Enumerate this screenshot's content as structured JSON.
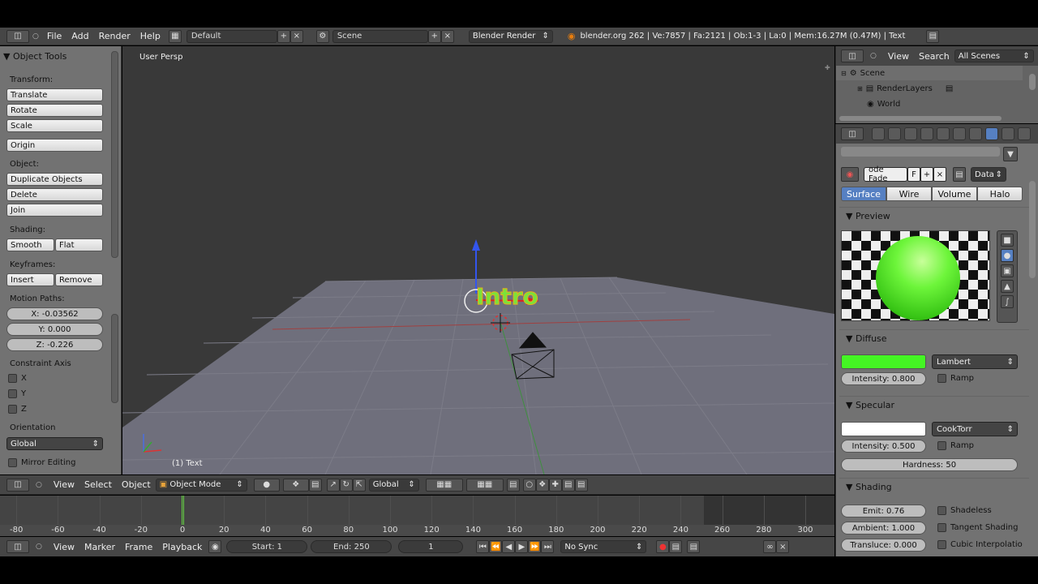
{
  "top": {
    "menus": [
      "File",
      "Add",
      "Render",
      "Help"
    ],
    "layout": "Default",
    "scene": "Scene",
    "engine": "Blender Render",
    "stats": "blender.org 262 | Ve:7857 | Fa:2121 | Ob:1-3 | La:0 | Mem:16.27M (0.47M) | Text"
  },
  "toolshelf": {
    "title": "Object Tools",
    "transform_label": "Transform:",
    "translate": "Translate",
    "rotate": "Rotate",
    "scale": "Scale",
    "origin": "Origin",
    "object_label": "Object:",
    "duplicate": "Duplicate Objects",
    "delete": "Delete",
    "join": "Join",
    "shading_label": "Shading:",
    "smooth": "Smooth",
    "flat": "Flat",
    "keyframes_label": "Keyframes:",
    "insert": "Insert",
    "remove": "Remove",
    "motion_label": "Motion Paths:",
    "x": "X: -0.03562",
    "y": "Y: 0.000",
    "z": "Z: -0.226",
    "constraint_label": "Constraint Axis",
    "cx": "X",
    "cy": "Y",
    "cz": "Z",
    "orientation_label": "Orientation",
    "orientation": "Global",
    "mirror": "Mirror Editing"
  },
  "viewport": {
    "view_name": "User Persp",
    "object_label": "(1) Text",
    "text_object": "Intro"
  },
  "vp_header": {
    "view": "View",
    "select": "Select",
    "object": "Object",
    "mode": "Object Mode",
    "orientation": "Global"
  },
  "timeline": {
    "ticks": [
      "-80",
      "-60",
      "-40",
      "-20",
      "0",
      "20",
      "40",
      "60",
      "80",
      "100",
      "120",
      "140",
      "160",
      "180",
      "200",
      "220",
      "240",
      "260",
      "280",
      "300"
    ],
    "current_frame_marker": 0
  },
  "tl_header": {
    "view": "View",
    "marker": "Marker",
    "frame": "Frame",
    "playback": "Playback",
    "start": "Start: 1",
    "end": "End: 250",
    "current": "1",
    "sync": "No Sync"
  },
  "outliner": {
    "view": "View",
    "search": "Search",
    "filter": "All Scenes",
    "scene": "Scene",
    "renderlayers": "RenderLayers",
    "world": "World"
  },
  "properties": {
    "material_name": "ode Fade",
    "fake_user": "F",
    "data": "Data",
    "tabs": [
      "Surface",
      "Wire",
      "Volume",
      "Halo"
    ],
    "preview": "Preview",
    "diffuse": "Diffuse",
    "diffuse_color": "#44f524",
    "diffuse_shader": "Lambert",
    "diffuse_intensity": "Intensity: 0.800",
    "ramp": "Ramp",
    "specular": "Specular",
    "specular_color": "#ffffff",
    "specular_shader": "CookTorr",
    "specular_intensity": "Intensity: 0.500",
    "hardness": "Hardness: 50",
    "shading": "Shading",
    "emit": "Emit: 0.76",
    "ambient": "Ambient: 1.000",
    "translucency": "Transluce: 0.000",
    "shadeless": "Shadeless",
    "tangent": "Tangent Shading",
    "cubic": "Cubic Interpolatio"
  }
}
